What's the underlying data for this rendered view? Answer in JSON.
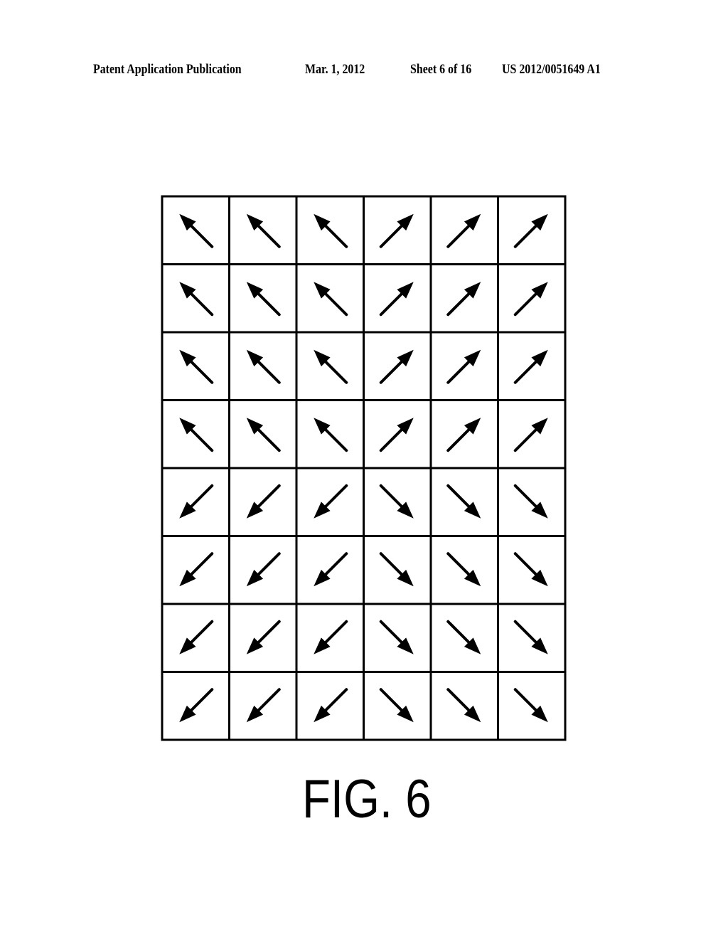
{
  "header": {
    "publication": "Patent Application Publication",
    "date": "Mar. 1, 2012",
    "sheet": "Sheet 6 of 16",
    "number": "US 2012/0051649 A1"
  },
  "figure": {
    "label": "FIG. 6",
    "columns": 6,
    "rows": 8,
    "arrow_directions": [
      [
        "NW",
        "NW",
        "NW",
        "NE",
        "NE",
        "NE"
      ],
      [
        "NW",
        "NW",
        "NW",
        "NE",
        "NE",
        "NE"
      ],
      [
        "NW",
        "NW",
        "NW",
        "NE",
        "NE",
        "NE"
      ],
      [
        "NW",
        "NW",
        "NW",
        "NE",
        "NE",
        "NE"
      ],
      [
        "SW",
        "SW",
        "SW",
        "SE",
        "SE",
        "SE"
      ],
      [
        "SW",
        "SW",
        "SW",
        "SE",
        "SE",
        "SE"
      ],
      [
        "SW",
        "SW",
        "SW",
        "SE",
        "SE",
        "SE"
      ],
      [
        "SW",
        "SW",
        "SW",
        "SE",
        "SE",
        "SE"
      ]
    ]
  }
}
